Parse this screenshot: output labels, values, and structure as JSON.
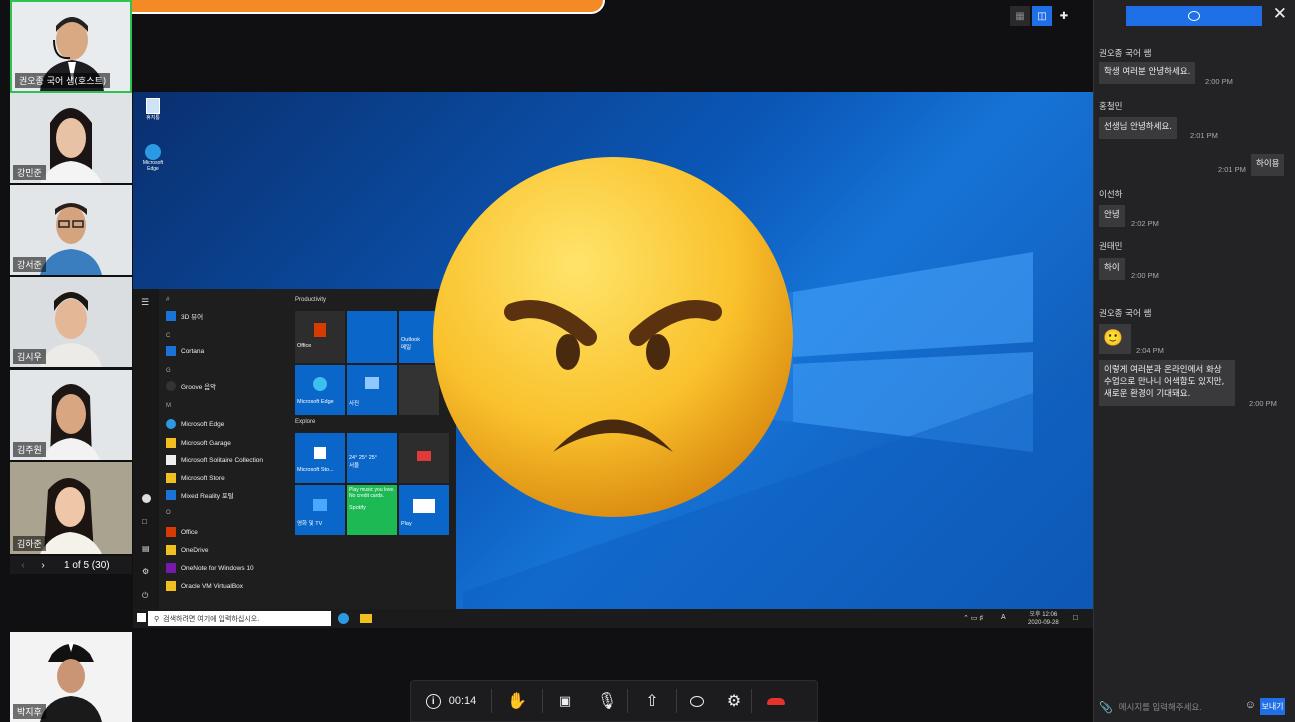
{
  "participants": [
    {
      "name": "권오종 국어 샘(호스트)",
      "top": 0
    },
    {
      "name": "강민준"
    },
    {
      "name": "강서준"
    },
    {
      "name": "김시우"
    },
    {
      "name": "김주원"
    },
    {
      "name": "김하준"
    },
    {
      "name": "박지후"
    }
  ],
  "pager": {
    "label": "1 of 5 (30)"
  },
  "screen": {
    "desktop_icons": [
      "휴지통",
      "Microsoft Edge"
    ],
    "start_sections": {
      "productivity": "Productivity",
      "explore": "Explore"
    },
    "apps": [
      {
        "group": "#",
        "label": "3D 뷰어"
      },
      {
        "group": "C",
        "label": "Cortana"
      },
      {
        "group": "G",
        "label": "Groove 음악"
      },
      {
        "group": "M",
        "label": "Microsoft Edge"
      },
      {
        "label": "Microsoft Garage"
      },
      {
        "label": "Microsoft Solitaire Collection"
      },
      {
        "label": "Microsoft Store"
      },
      {
        "label": "Mixed Reality 포털"
      },
      {
        "group": "O",
        "label": "Office"
      },
      {
        "label": "OneDrive"
      },
      {
        "label": "OneNote for Windows 10"
      },
      {
        "label": "Oracle VM VirtualBox"
      }
    ],
    "tiles": {
      "office": "Office",
      "outlook": "Outlook",
      "mail": "메일",
      "edge": "Microsoft Edge",
      "photos": "사진",
      "store": "Microsoft Sto...",
      "weather_city": "서울",
      "weather_temps": "24° 25° 25°",
      "movies": "영화 및 TV",
      "spotify_text": "Play music you love. No credit cards.",
      "spotify": "Spotify",
      "play": "Play"
    },
    "taskbar_search": "검색하려면 여기에 입력하십시오.",
    "clock_time": "오후 12:06",
    "clock_date": "2020-09-28",
    "ime": "A"
  },
  "chat": {
    "messages": [
      {
        "sender": "권오종 국어 쌤",
        "text": "학생 여러분 안녕하세요.",
        "time": "2:00 PM"
      },
      {
        "sender": "홍철민",
        "text": "선생님 안녕하세요.",
        "time": "2:01 PM"
      },
      {
        "sender": "",
        "text": "하이용",
        "time": "2:01 PM",
        "mine": true
      },
      {
        "sender": "이선하",
        "text": "안녕",
        "time": "2:02 PM"
      },
      {
        "sender": "권태민",
        "text": "하이",
        "time": "2:00 PM"
      },
      {
        "sender": "권오종 국어 쌤",
        "text": "🙂",
        "time": "2:04 PM"
      },
      {
        "sender": "",
        "text": "이렇게 여러분과 온라인에서 화상 수업으로 만나니 어색함도 있지만, 새로운 환경이 기대돼요.",
        "time": "2:00 PM"
      }
    ],
    "input_placeholder": "메시지를 입력해주세요.",
    "send_label": "보내기"
  },
  "toolbar": {
    "timer": "00:14"
  },
  "colors": {
    "accent": "#1f6fe6",
    "host_border": "#2fc152",
    "callout": "#f38a26",
    "end_call": "#e5322d"
  }
}
